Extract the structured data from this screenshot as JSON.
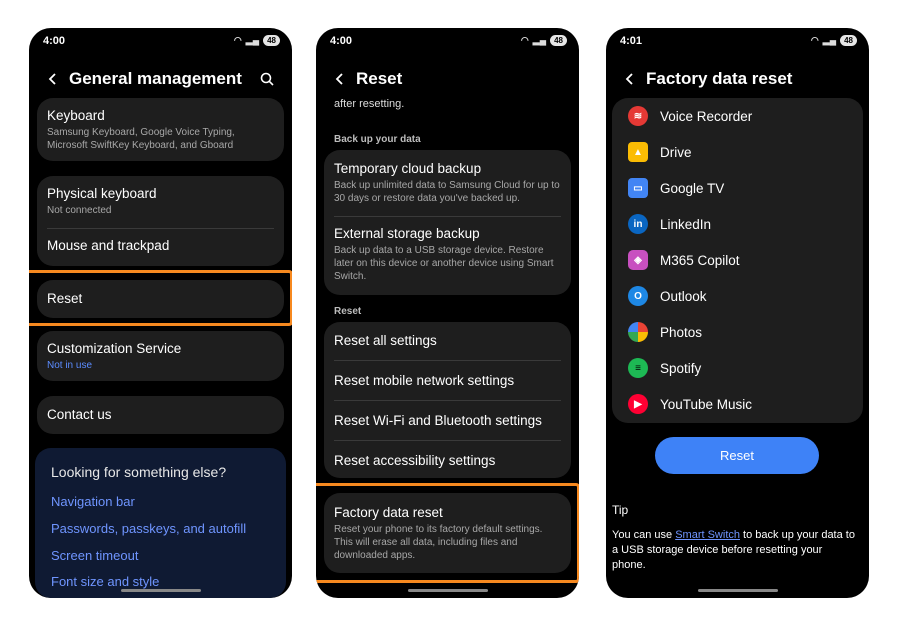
{
  "screen1": {
    "time": "4:00",
    "battery": "48",
    "title": "General management",
    "keyboard": {
      "title": "Keyboard",
      "sub": "Samsung Keyboard, Google Voice Typing, Microsoft SwiftKey Keyboard, and Gboard"
    },
    "physical_keyboard": {
      "title": "Physical keyboard",
      "sub": "Not connected"
    },
    "mouse": {
      "title": "Mouse and trackpad"
    },
    "reset": {
      "title": "Reset"
    },
    "customization": {
      "title": "Customization Service",
      "sub": "Not in use"
    },
    "contact": {
      "title": "Contact us"
    },
    "looking": {
      "title": "Looking for something else?",
      "links": [
        "Navigation bar",
        "Passwords, passkeys, and autofill",
        "Screen timeout",
        "Font size and style"
      ]
    }
  },
  "screen2": {
    "time": "4:00",
    "battery": "48",
    "title": "Reset",
    "top_text": "after resetting.",
    "section_backup": "Back up your data",
    "temp_backup": {
      "title": "Temporary cloud backup",
      "sub": "Back up unlimited data to Samsung Cloud for up to 30 days or restore data you've backed up."
    },
    "ext_backup": {
      "title": "External storage backup",
      "sub": "Back up data to a USB storage device. Restore later on this device or another device using Smart Switch."
    },
    "section_reset": "Reset",
    "reset_items": [
      "Reset all settings",
      "Reset mobile network settings",
      "Reset Wi-Fi and Bluetooth settings",
      "Reset accessibility settings"
    ],
    "factory": {
      "title": "Factory data reset",
      "sub": "Reset your phone to its factory default settings. This will erase all data, including files and downloaded apps."
    }
  },
  "screen3": {
    "time": "4:01",
    "battery": "48",
    "title": "Factory data reset",
    "apps": [
      {
        "name": "Voice Recorder",
        "icon": "voice-recorder-icon",
        "color": "#e53935"
      },
      {
        "name": "Drive",
        "icon": "drive-icon",
        "color": "#fbbc04"
      },
      {
        "name": "Google TV",
        "icon": "google-tv-icon",
        "color": "#4285f4"
      },
      {
        "name": "LinkedIn",
        "icon": "linkedin-icon",
        "color": "#0a66c2"
      },
      {
        "name": "M365 Copilot",
        "icon": "m365-copilot-icon",
        "color": "#c850c0"
      },
      {
        "name": "Outlook",
        "icon": "outlook-icon",
        "color": "#1e88e5"
      },
      {
        "name": "Photos",
        "icon": "photos-icon",
        "color": "#ea4335"
      },
      {
        "name": "Spotify",
        "icon": "spotify-icon",
        "color": "#1db954"
      },
      {
        "name": "YouTube Music",
        "icon": "youtube-music-icon",
        "color": "#ff0033"
      }
    ],
    "reset_button": "Reset",
    "tip_label": "Tip",
    "tip_before": "You can use ",
    "tip_link": "Smart Switch",
    "tip_after": " to back up your data to a USB storage device before resetting your phone."
  },
  "colors": {
    "highlight": "#f7891f",
    "accent": "#3e82f7",
    "link": "#6f95ff"
  }
}
